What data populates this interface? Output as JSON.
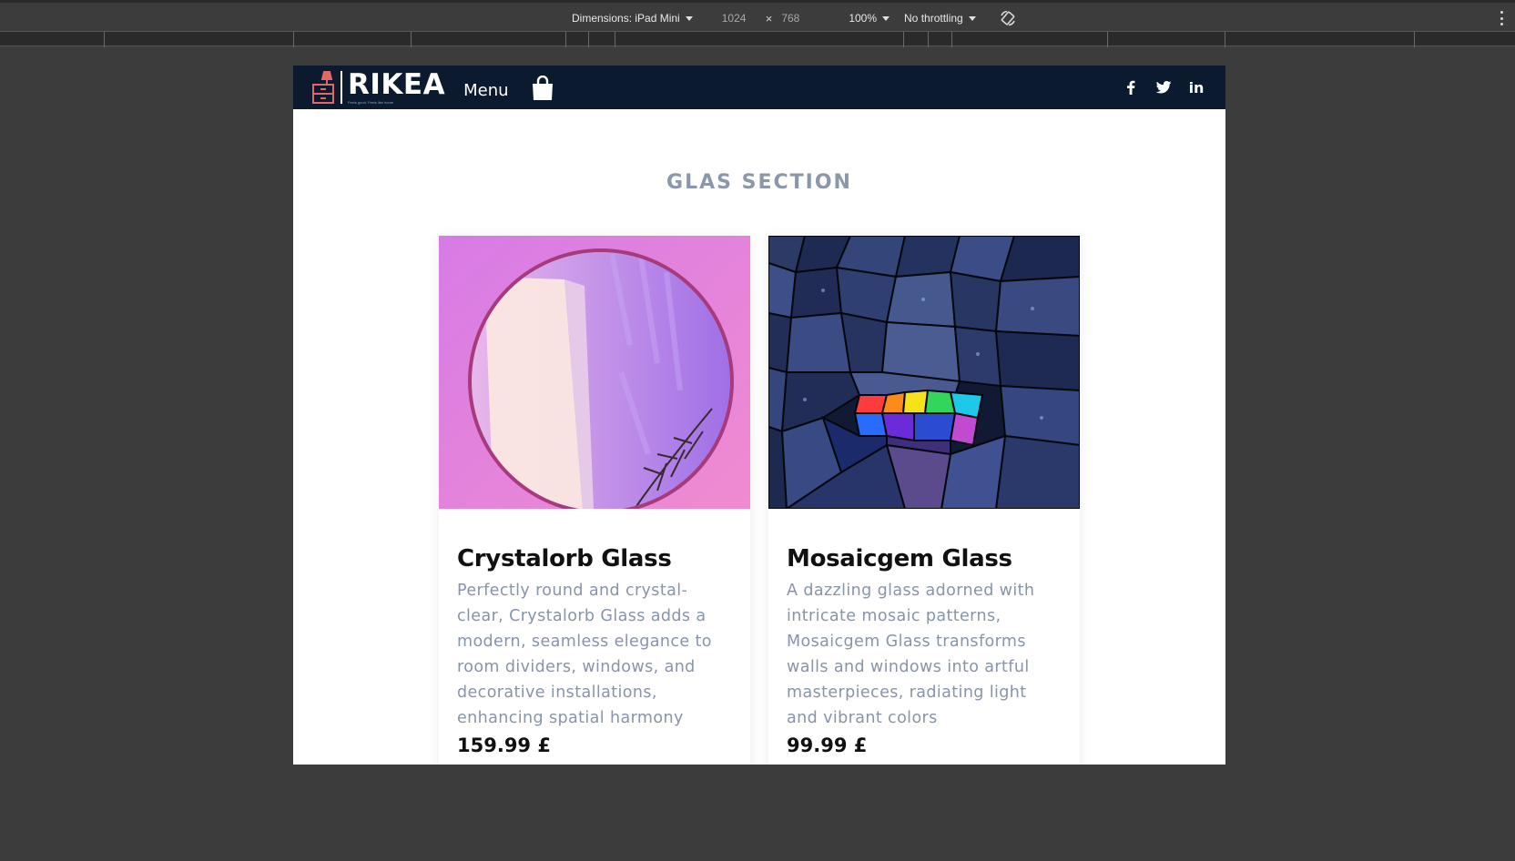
{
  "devtools": {
    "dimensions_label": "Dimensions: iPad Mini",
    "width": "1024",
    "times": "×",
    "height": "768",
    "zoom": "100%",
    "throttling": "No throttling"
  },
  "site": {
    "logo_text": "RIKEA",
    "logo_tagline": "Feels good. Feels like home",
    "menu_label": "Menu",
    "social": [
      "facebook-icon",
      "twitter-icon",
      "linkedin-icon"
    ],
    "linkedin_text": "in"
  },
  "section": {
    "title": "GLAS SECTION"
  },
  "products": [
    {
      "title": "Crystalorb Glass",
      "description": "Perfectly round and crystal-clear, Crystalorb Glass adds a modern, seamless elegance to room dividers, windows, and decorative installations, enhancing spatial harmony",
      "price": "159.99 £"
    },
    {
      "title": "Mosaicgem Glass",
      "description": "A dazzling glass adorned with intricate mosaic patterns, Mosaicgem Glass transforms walls and windows into artful masterpieces, radiating light and vibrant colors",
      "price": "99.99 £"
    }
  ],
  "colors": {
    "nav_bg": "#0b1a2f",
    "section_title": "#8b97ab",
    "description": "#8894a8",
    "logo_accent": "#e0676a"
  }
}
